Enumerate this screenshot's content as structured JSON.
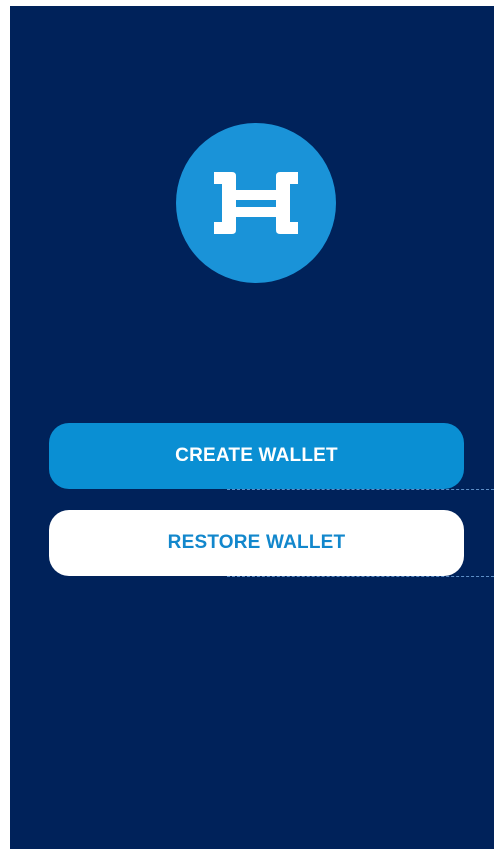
{
  "app": {
    "logo_icon": "hashgraph-h-icon",
    "background_color": "#00225a",
    "logo_color": "#1a93d8"
  },
  "actions": {
    "create_label": "CREATE WALLET",
    "restore_label": "RESTORE WALLET"
  },
  "colors": {
    "create_button_bg": "#0a8fd3",
    "restore_button_bg": "#ffffff",
    "restore_button_text": "#1287cc"
  }
}
